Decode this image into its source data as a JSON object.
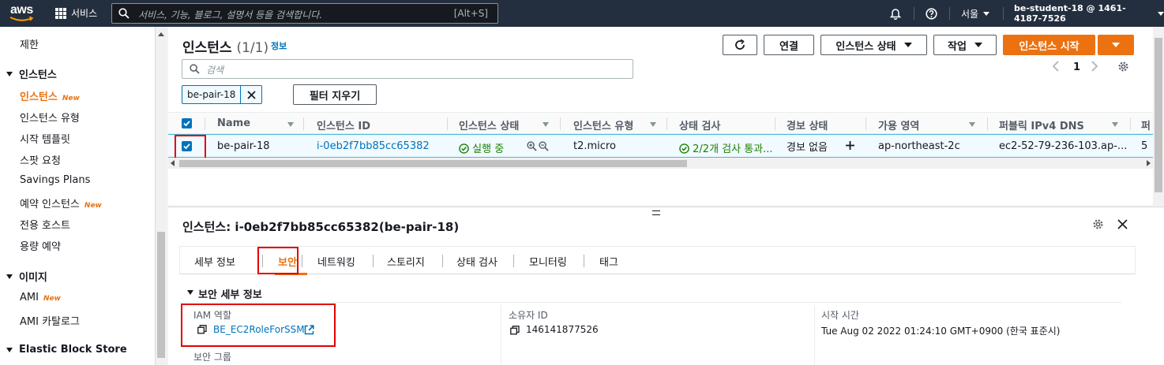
{
  "topbar": {
    "logo_text": "aws",
    "services_label": "서비스",
    "search_placeholder": "서비스, 기능, 블로그, 설명서 등을 검색합니다.",
    "search_shortcut": "[Alt+S]",
    "region": "서울",
    "account": "be-student-18 @ 1461-4187-7526"
  },
  "sidebar": {
    "items": [
      {
        "label": "제한"
      },
      {
        "label": "인스턴스",
        "section": true
      },
      {
        "label": "인스턴스",
        "new": "New",
        "active": true
      },
      {
        "label": "인스턴스 유형"
      },
      {
        "label": "시작 템플릿"
      },
      {
        "label": "스팟 요청"
      },
      {
        "label": "Savings Plans"
      },
      {
        "label": "예약 인스턴스",
        "new": "New"
      },
      {
        "label": "전용 호스트"
      },
      {
        "label": "용량 예약"
      },
      {
        "label": "이미지",
        "section": true
      },
      {
        "label": "AMI",
        "new": "New"
      },
      {
        "label": "AMI 카탈로그"
      },
      {
        "label": "Elastic Block Store",
        "section": true
      }
    ]
  },
  "instances": {
    "title": "인스턴스",
    "count": "(1/1)",
    "info_link": "정보",
    "buttons": {
      "connect": "연결",
      "instance_state": "인스턴스 상태",
      "actions": "작업",
      "launch": "인스턴스 시작"
    },
    "search_placeholder": "검색",
    "filter_token": "be-pair-18",
    "clear_filters": "필터 지우기",
    "page": "1",
    "columns": [
      "Name",
      "인스턴스 ID",
      "인스턴스 상태",
      "인스턴스 유형",
      "상태 검사",
      "경보 상태",
      "가용 영역",
      "퍼블릭 IPv4 DNS",
      "퍼"
    ],
    "rows": [
      {
        "name": "be-pair-18",
        "instance_id": "i-0eb2f7bb85cc65382",
        "state": "실행 중",
        "type": "t2.micro",
        "status_check": "2/2개 검사 통과...",
        "alarm": "경보 없음",
        "az": "ap-northeast-2c",
        "dns": "ec2-52-79-236-103.ap-...",
        "extra": "5"
      }
    ]
  },
  "detail": {
    "title": "인스턴스: i-0eb2f7bb85cc65382(be-pair-18)",
    "tabs": [
      "세부 정보",
      "보안",
      "네트워킹",
      "스토리지",
      "상태 검사",
      "모니터링",
      "태그"
    ],
    "active_tab": "보안",
    "section_title": "보안 세부 정보",
    "fields": {
      "iam_role_label": "IAM 역할",
      "iam_role_value": "BE_EC2RoleForSSM",
      "owner_id_label": "소유자 ID",
      "owner_id_value": "146141877526",
      "launch_time_label": "시작 시간",
      "launch_time_value": "Tue Aug 02 2022 01:24:10 GMT+0900 (한국 표준시)",
      "security_groups_label": "보안 그룹"
    }
  },
  "colors": {
    "aws_dark": "#232f3e",
    "accent_orange": "#ec7211",
    "link_blue": "#0073bb",
    "success_green": "#1d8102",
    "highlight_red": "#e30000"
  }
}
